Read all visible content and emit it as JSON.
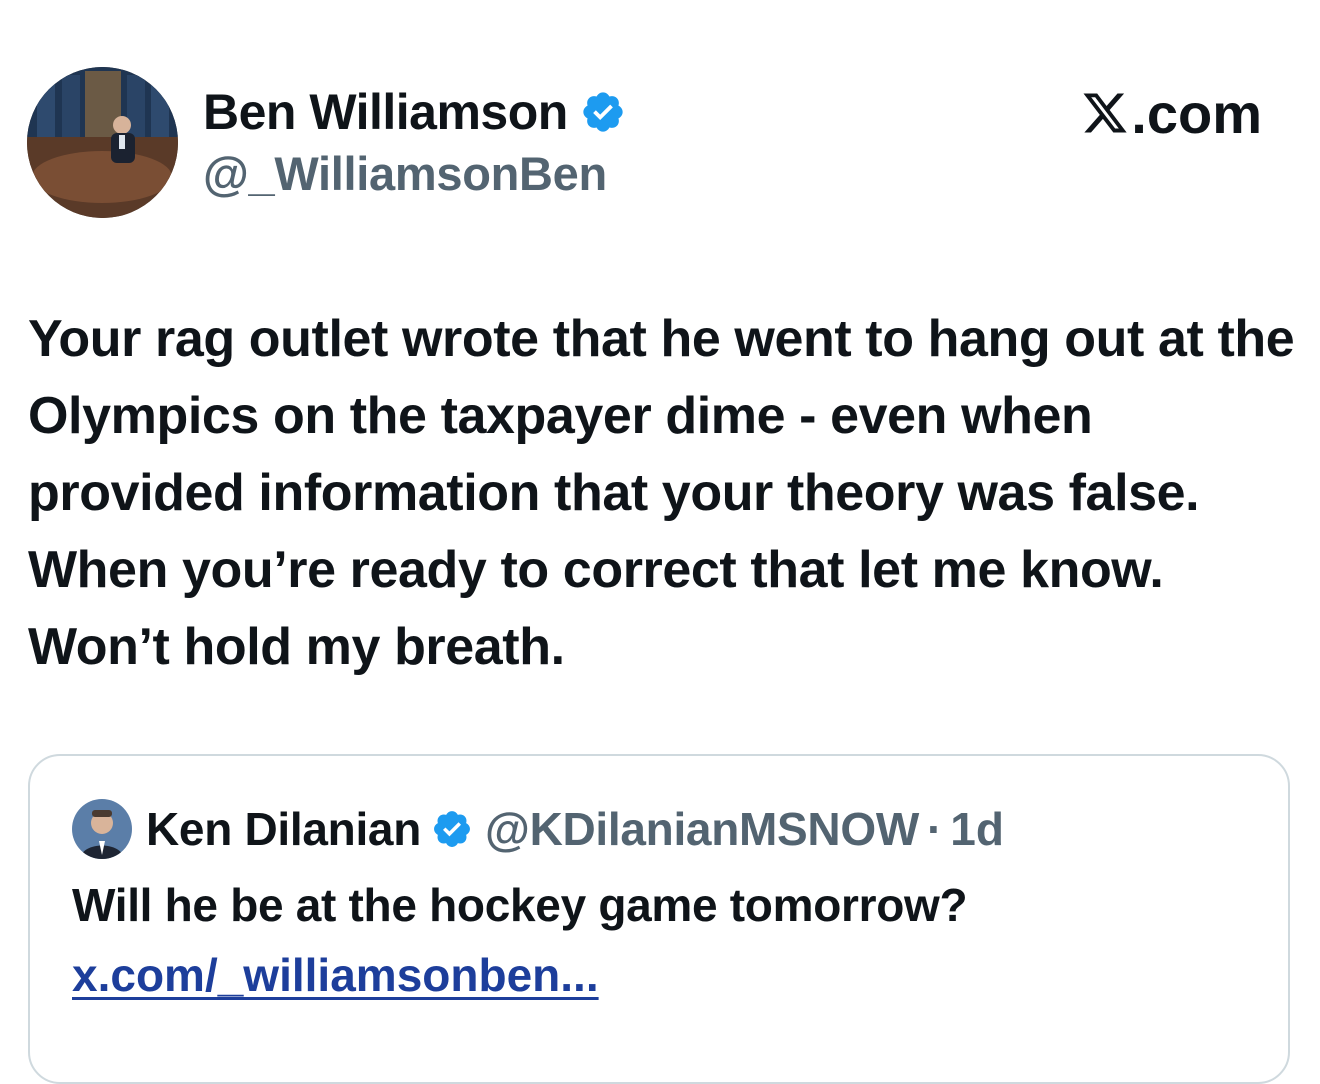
{
  "author": {
    "display_name": "Ben Williamson",
    "handle": "@_WilliamsonBen",
    "verified": true,
    "avatar_icon": "profile-photo"
  },
  "site": {
    "label": ".com",
    "logo_icon": "x-logo-icon"
  },
  "tweet": {
    "text": "Your rag outlet wrote that he went to hang out at the Olympics on the taxpayer dime - even when provided information that your theory was false. When you’re ready to correct that let me know. Won’t hold my breath."
  },
  "quoted_tweet": {
    "display_name": "Ken Dilanian",
    "handle": "@KDilanianMSNOW",
    "separator": "·",
    "time": "1d",
    "verified": true,
    "text": "Will he be at the hockey game tomorrow?",
    "link": "x.com/_williamsonben..."
  },
  "colors": {
    "primary_text": "#0f1419",
    "secondary_text": "#536471",
    "verified_blue": "#1d9bf0",
    "link": "#1d3e9b",
    "border": "#cfd9de"
  }
}
